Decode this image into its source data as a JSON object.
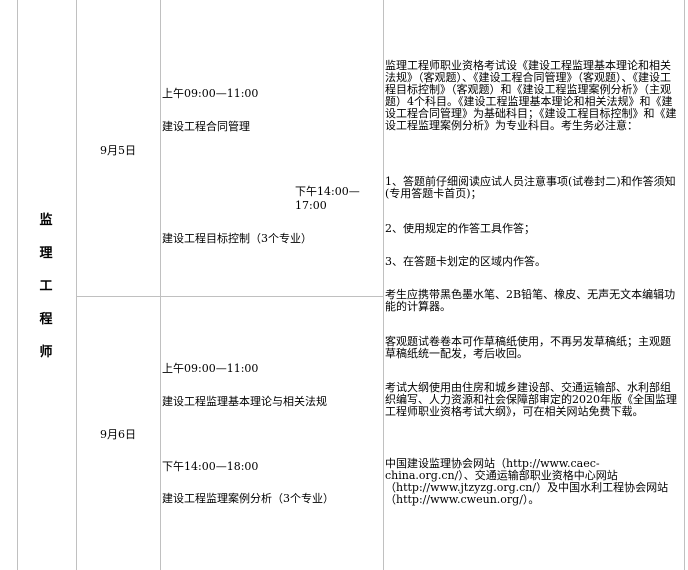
{
  "category": {
    "chars": [
      "监",
      "理",
      "工",
      "程",
      "师"
    ]
  },
  "sessions": [
    {
      "date": "9月5日",
      "morning_time": "上午09:00—11:00",
      "morning_subject": "建设工程合同管理",
      "afternoon_time_line1": "下午14:00—",
      "afternoon_time_line2": "17:00",
      "afternoon_subject": "建设工程目标控制（3个专业）"
    },
    {
      "date": "9月6日",
      "morning_time": "上午09:00—11:00",
      "morning_subject": "建设工程监理基本理论与相关法规",
      "afternoon_time": "下午14:00—18:00",
      "afternoon_subject": "建设工程监理案例分析（3个专业）"
    }
  ],
  "notes": {
    "intro": "监理工程师职业资格考试设《建设工程监理基本理论和相关法规》（客观题）、《建设工程合同管理》（客观题）、《建设工程目标控制》（客观题）和《建设工程监理案例分析》（主观题）4个科目。《建设工程监理基本理论和相关法规》和《建设工程合同管理》为基础科目；《建设工程目标控制》和《建设工程监理案例分析》为专业科目。考生务必注意：",
    "item1": "1、答题前仔细阅读应试人员注意事项(试卷封二)和作答须知(专用答题卡首页)；",
    "item2": "2、使用规定的作答工具作答；",
    "item3": "3、在答题卡划定的区域内作答。",
    "tools": "考生应携带黑色墨水笔、2B铅笔、橡皮、无声无文本编辑功能的计算器。",
    "draft": "客观题试卷卷本可作草稿纸使用，不再另发草稿纸；主观题草稿纸统一配发，考后收回。",
    "outline": "考试大纲使用由住房和城乡建设部、交通运输部、水利部组织编写、人力资源和社会保障部审定的2020年版《全国监理工程师职业资格考试大纲》，可在相关网站免费下载。",
    "sites": "中国建设监理协会网站（http://www.caec-china.org.cn/）、交通运输部职业资格中心网站（http://www.jtzyzg.org.cn/）及中国水利工程协会网站（http://www.cweun.org/）。"
  }
}
